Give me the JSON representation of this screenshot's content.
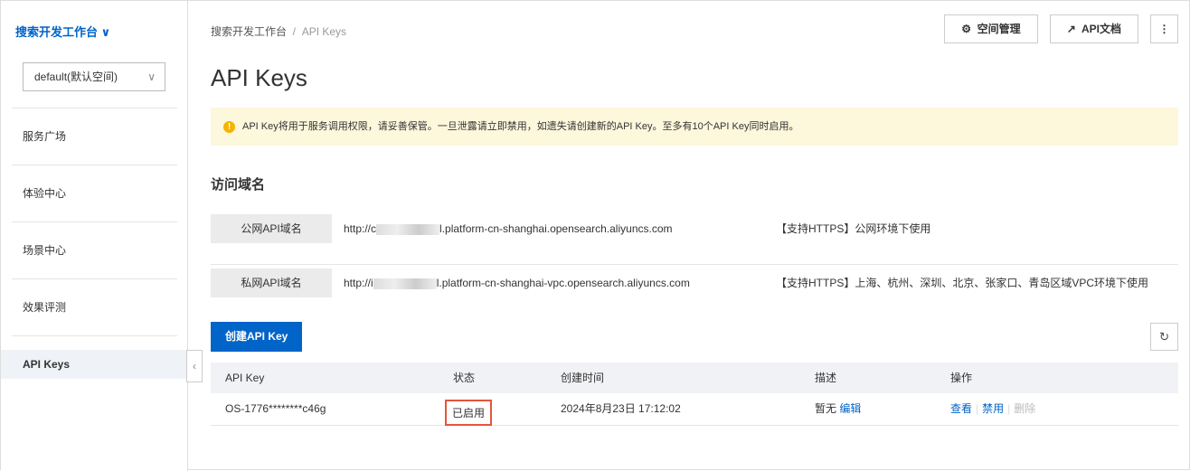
{
  "sidebar": {
    "workspace": "搜索开发工作台",
    "space": "default(默认空间)",
    "items": [
      "服务广场",
      "体验中心",
      "场景中心",
      "效果评测",
      "API Keys"
    ]
  },
  "header": {
    "breadcrumb": [
      "搜索开发工作台",
      "API Keys"
    ],
    "title": "API Keys",
    "buttons": {
      "space": "空间管理",
      "docs": "API文档"
    }
  },
  "alert": "API Key将用于服务调用权限，请妥善保管。一旦泄露请立即禁用，如遗失请创建新的API Key。至多有10个API Key同时启用。",
  "domains": {
    "title": "访问域名",
    "rows": [
      {
        "label": "公网API域名",
        "prefix": "http://c",
        "suffix": "l.platform-cn-shanghai.opensearch.aliyuncs.com",
        "note": "【支持HTTPS】公网环境下使用"
      },
      {
        "label": "私网API域名",
        "prefix": "http://i",
        "suffix": "l.platform-cn-shanghai-vpc.opensearch.aliyuncs.com",
        "note": "【支持HTTPS】上海、杭州、深圳、北京、张家口、青岛区域VPC环境下使用"
      }
    ]
  },
  "create_label": "创建API Key",
  "table": {
    "headers": [
      "API Key",
      "状态",
      "创建时间",
      "描述",
      "操作"
    ],
    "rows": [
      {
        "key": "OS-1776********c46g",
        "status": "已启用",
        "created": "2024年8月23日 17:12:02",
        "desc": "暂无",
        "edit": "编辑",
        "actions": [
          "查看",
          "禁用",
          "删除"
        ]
      }
    ]
  }
}
